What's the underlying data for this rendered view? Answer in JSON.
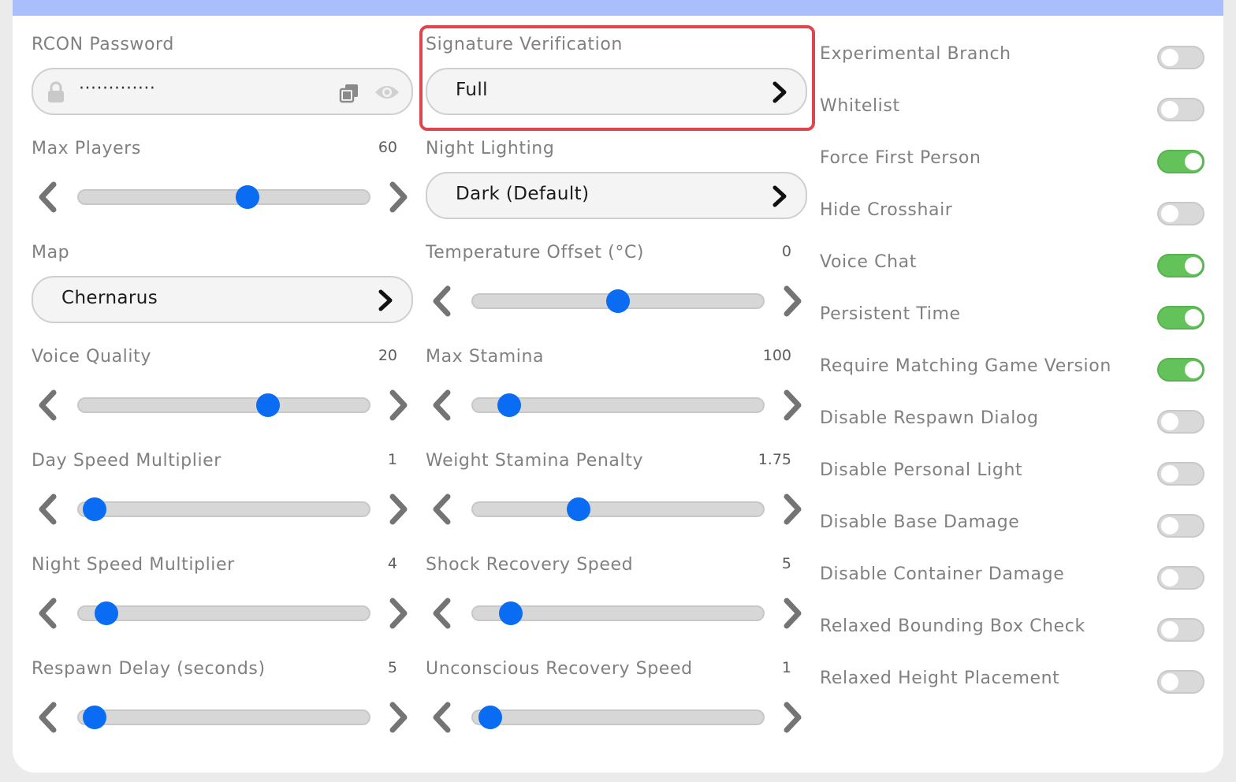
{
  "col1": {
    "rcon": {
      "label": "RCON Password",
      "masked_value": "·············"
    },
    "max_players": {
      "label": "Max Players",
      "value": "60",
      "position": 0.58
    },
    "map": {
      "label": "Map",
      "selected": "Chernarus"
    },
    "voice_quality": {
      "label": "Voice Quality",
      "value": "20",
      "position": 0.65
    },
    "day_speed": {
      "label": "Day Speed Multiplier",
      "value": "1",
      "position": 0.06
    },
    "night_speed": {
      "label": "Night Speed Multiplier",
      "value": "4",
      "position": 0.1
    },
    "respawn_delay": {
      "label": "Respawn Delay (seconds)",
      "value": "5",
      "position": 0.06
    }
  },
  "col2": {
    "signature": {
      "label": "Signature Verification",
      "selected": "Full"
    },
    "night_lighting": {
      "label": "Night Lighting",
      "selected": "Dark (Default)"
    },
    "temp_offset": {
      "label": "Temperature Offset (°C)",
      "value": "0",
      "position": 0.5
    },
    "max_stamina": {
      "label": "Max Stamina",
      "value": "100",
      "position": 0.13
    },
    "weight_stamina": {
      "label": "Weight Stamina Penalty",
      "value": "1.75",
      "position": 0.365
    },
    "shock_recovery": {
      "label": "Shock Recovery Speed",
      "value": "5",
      "position": 0.135
    },
    "unconscious_recovery": {
      "label": "Unconscious Recovery Speed",
      "value": "1",
      "position": 0.065
    }
  },
  "toggles": [
    {
      "label": "Experimental Branch",
      "on": false
    },
    {
      "label": "Whitelist",
      "on": false
    },
    {
      "label": "Force First Person",
      "on": true
    },
    {
      "label": "Hide Crosshair",
      "on": false
    },
    {
      "label": "Voice Chat",
      "on": true
    },
    {
      "label": "Persistent Time",
      "on": true
    },
    {
      "label": "Require Matching Game Version",
      "on": true
    },
    {
      "label": "Disable Respawn Dialog",
      "on": false
    },
    {
      "label": "Disable Personal Light",
      "on": false
    },
    {
      "label": "Disable Base Damage",
      "on": false
    },
    {
      "label": "Disable Container Damage",
      "on": false
    },
    {
      "label": "Relaxed Bounding Box Check",
      "on": false
    },
    {
      "label": "Relaxed Height Placement",
      "on": false
    }
  ],
  "colors": {
    "accent": "#0a6cf2",
    "toggle_on": "#63c25a",
    "toggle_off": "#d9d9d9",
    "highlight": "#e0454e",
    "topbar": "#a9befa"
  },
  "icons": {
    "lock": "lock-icon",
    "copy": "copy-icon",
    "eye": "eye-icon",
    "chevron": "chevron-right-icon"
  }
}
